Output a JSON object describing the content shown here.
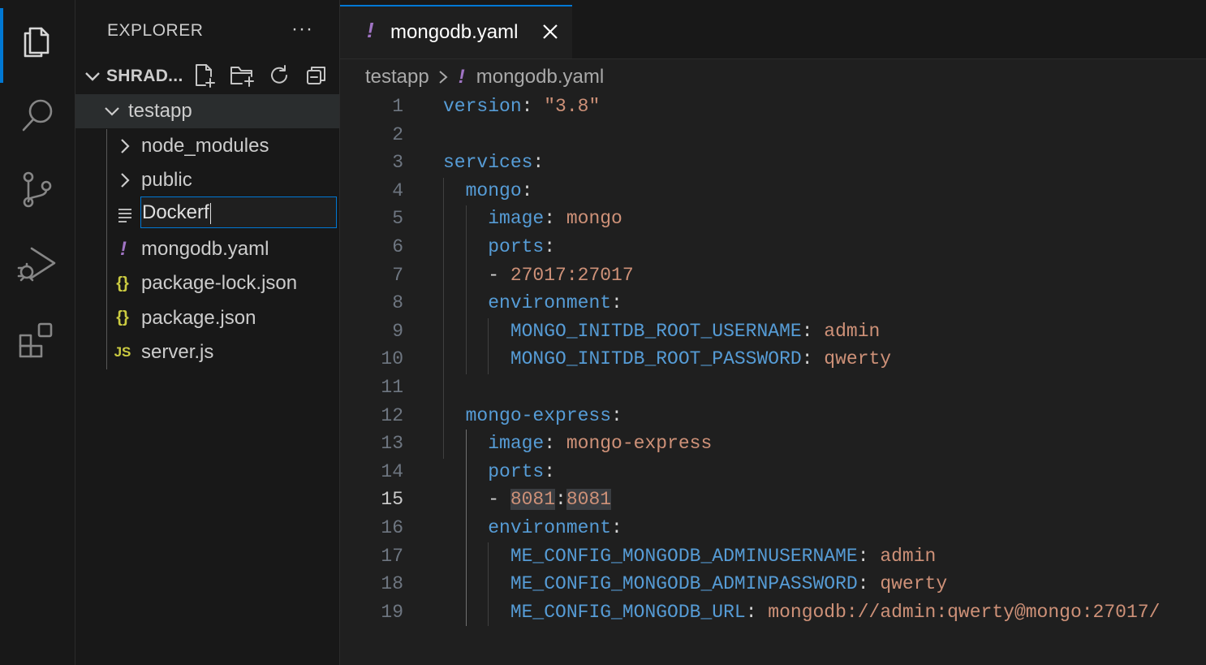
{
  "sidebar": {
    "title": "EXPLORER",
    "more": "···",
    "root_label": "SHRAD...",
    "items": [
      {
        "label": "testapp",
        "kind": "folder-open",
        "icon": "chevron-down-icon"
      },
      {
        "label": "node_modules",
        "kind": "folder",
        "icon": "chevron-right-icon"
      },
      {
        "label": "public",
        "kind": "folder",
        "icon": "chevron-right-icon"
      },
      {
        "label": "",
        "kind": "rename",
        "icon": "lines-icon"
      },
      {
        "label": "mongodb.yaml",
        "kind": "file",
        "icon": "yaml-icon",
        "glyph": "!"
      },
      {
        "label": "package-lock.json",
        "kind": "file",
        "icon": "json-icon",
        "glyph": "{}"
      },
      {
        "label": "package.json",
        "kind": "file",
        "icon": "json-icon",
        "glyph": "{}"
      },
      {
        "label": "server.js",
        "kind": "file",
        "icon": "js-icon",
        "glyph": "JS"
      }
    ],
    "rename_value": "Dockerf"
  },
  "tab": {
    "label": "mongodb.yaml",
    "glyph": "!"
  },
  "breadcrumb": {
    "folder": "testapp",
    "file": "mongodb.yaml",
    "glyph": "!"
  },
  "editor": {
    "current_line": 15,
    "lines": [
      {
        "n": "1",
        "tokens": [
          [
            "k",
            "version"
          ],
          [
            "p",
            ": "
          ],
          [
            "s",
            "\"3.8\""
          ]
        ]
      },
      {
        "n": "2",
        "tokens": []
      },
      {
        "n": "3",
        "tokens": [
          [
            "k",
            "services"
          ],
          [
            "p",
            ":"
          ]
        ]
      },
      {
        "n": "4",
        "tokens": [
          [
            "p",
            "  "
          ],
          [
            "k",
            "mongo"
          ],
          [
            "p",
            ":"
          ]
        ]
      },
      {
        "n": "5",
        "tokens": [
          [
            "p",
            "    "
          ],
          [
            "k",
            "image"
          ],
          [
            "p",
            ": "
          ],
          [
            "s",
            "mongo"
          ]
        ]
      },
      {
        "n": "6",
        "tokens": [
          [
            "p",
            "    "
          ],
          [
            "k",
            "ports"
          ],
          [
            "p",
            ":"
          ]
        ]
      },
      {
        "n": "7",
        "tokens": [
          [
            "p",
            "    - "
          ],
          [
            "s",
            "27017:27017"
          ]
        ]
      },
      {
        "n": "8",
        "tokens": [
          [
            "p",
            "    "
          ],
          [
            "k",
            "environment"
          ],
          [
            "p",
            ":"
          ]
        ]
      },
      {
        "n": "9",
        "tokens": [
          [
            "p",
            "      "
          ],
          [
            "k",
            "MONGO_INITDB_ROOT_USERNAME"
          ],
          [
            "p",
            ": "
          ],
          [
            "s",
            "admin"
          ]
        ]
      },
      {
        "n": "10",
        "tokens": [
          [
            "p",
            "      "
          ],
          [
            "k",
            "MONGO_INITDB_ROOT_PASSWORD"
          ],
          [
            "p",
            ": "
          ],
          [
            "s",
            "qwerty"
          ]
        ]
      },
      {
        "n": "11",
        "tokens": []
      },
      {
        "n": "12",
        "tokens": [
          [
            "p",
            "  "
          ],
          [
            "k",
            "mongo-express"
          ],
          [
            "p",
            ":"
          ]
        ]
      },
      {
        "n": "13",
        "tokens": [
          [
            "p",
            "    "
          ],
          [
            "k",
            "image"
          ],
          [
            "p",
            ": "
          ],
          [
            "s",
            "mongo-express"
          ]
        ]
      },
      {
        "n": "14",
        "tokens": [
          [
            "p",
            "    "
          ],
          [
            "k",
            "ports"
          ],
          [
            "p",
            ":"
          ]
        ]
      },
      {
        "n": "15",
        "tokens": [
          [
            "p",
            "    - "
          ],
          [
            "hs",
            "8081"
          ],
          [
            "p",
            ":"
          ],
          [
            "hs",
            "8081"
          ]
        ]
      },
      {
        "n": "16",
        "tokens": [
          [
            "p",
            "    "
          ],
          [
            "k",
            "environment"
          ],
          [
            "p",
            ":"
          ]
        ]
      },
      {
        "n": "17",
        "tokens": [
          [
            "p",
            "      "
          ],
          [
            "k",
            "ME_CONFIG_MONGODB_ADMINUSERNAME"
          ],
          [
            "p",
            ": "
          ],
          [
            "s",
            "admin"
          ]
        ]
      },
      {
        "n": "18",
        "tokens": [
          [
            "p",
            "      "
          ],
          [
            "k",
            "ME_CONFIG_MONGODB_ADMINPASSWORD"
          ],
          [
            "p",
            ": "
          ],
          [
            "s",
            "qwerty"
          ]
        ]
      },
      {
        "n": "19",
        "tokens": [
          [
            "p",
            "      "
          ],
          [
            "k",
            "ME_CONFIG_MONGODB_URL"
          ],
          [
            "p",
            ": "
          ],
          [
            "s",
            "mongodb://admin:qwerty@mongo:27017/"
          ]
        ]
      }
    ]
  },
  "colors": {
    "accent": "#0078d4",
    "keyword": "#569cd6",
    "string": "#ce9178",
    "yaml_icon": "#a074c4",
    "json_icon": "#cbcb41"
  }
}
